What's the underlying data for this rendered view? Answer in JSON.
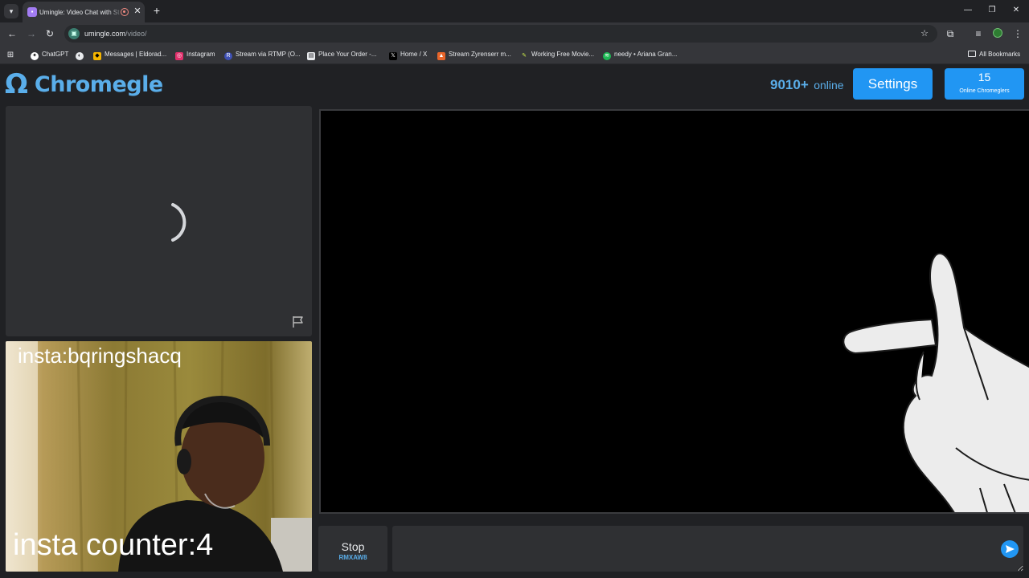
{
  "browser": {
    "tab_title": "Umingle: Video Chat with St",
    "url_domain": "umingle.com",
    "url_path": "/video/",
    "icons": {
      "tab_search": "chevron-down-icon",
      "favicon": "video-chat-favicon",
      "recording": "recording-icon",
      "close": "close-icon",
      "new_tab": "plus-icon",
      "back": "arrow-left-icon",
      "forward": "arrow-right-icon",
      "reload": "reload-icon",
      "star": "star-icon",
      "extensions": "puzzle-icon",
      "media": "media-control-icon",
      "profile": "avatar",
      "menu": "kebab-menu-icon"
    }
  },
  "bookmarks": [
    {
      "label": "ChatGPT",
      "icon": "chatgpt-icon"
    },
    {
      "label": "",
      "icon": "globe-icon"
    },
    {
      "label": "Messages | Eldorad...",
      "icon": "eldorado-icon"
    },
    {
      "label": "Instagram",
      "icon": "instagram-icon"
    },
    {
      "label": "Stream via RTMP (O...",
      "icon": "restream-icon"
    },
    {
      "label": "Place Your Order -...",
      "icon": "order-icon"
    },
    {
      "label": "Home / X",
      "icon": "x-icon"
    },
    {
      "label": "Stream Zyrenserr m...",
      "icon": "stream-icon"
    },
    {
      "label": "Working Free Movie...",
      "icon": "movie-icon"
    },
    {
      "label": "needy • Ariana Gran...",
      "icon": "spotify-icon"
    }
  ],
  "all_bookmarks_label": "All Bookmarks",
  "header": {
    "logo_symbol": "Ω",
    "logo_text": "Chromegle",
    "online_count": "9010+",
    "online_label": "online",
    "settings_label": "Settings",
    "chromeglers_count": "15",
    "chromeglers_label": "Online Chromeglers"
  },
  "self_video": {
    "overlay_top": "insta:bqringshacq",
    "overlay_bottom": "insta counter:4"
  },
  "controls": {
    "stop_label": "Stop",
    "stop_code": "RMXAW8",
    "chat_placeholder": ""
  },
  "colors": {
    "accent": "#2196f3",
    "brand": "#5aaeea",
    "background": "#202124",
    "panel": "#2f3033"
  }
}
